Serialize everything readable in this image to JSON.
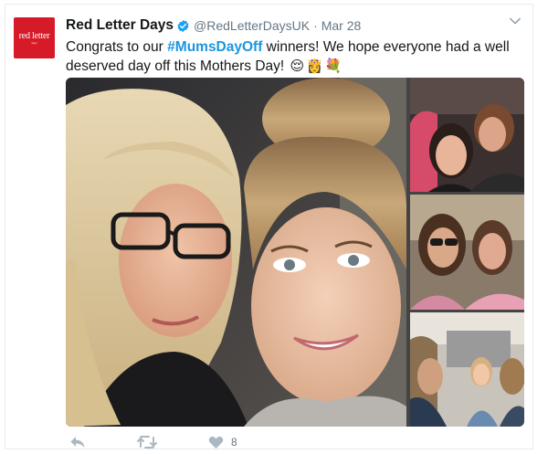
{
  "tweet": {
    "account_name": "Red Letter Days",
    "handle": "@RedLetterDaysUK",
    "separator": "·",
    "date": "Mar 28",
    "avatar_logo": "red letter",
    "avatar_logo_sub": "days",
    "text_before": "Congrats to our ",
    "hashtag": "#MumsDayOff",
    "text_after": " winners! We hope everyone had a well deserved day off this Mothers Day! ",
    "emojis": [
      "😌",
      "👸",
      "💐"
    ],
    "like_count": "8"
  },
  "icons": {
    "verified": "verified-badge-icon",
    "menu": "chevron-down-icon",
    "reply": "reply-icon",
    "retweet": "retweet-icon",
    "like": "heart-icon"
  },
  "colors": {
    "brand_red": "#d71a28",
    "hashtag_blue": "#1b95e0",
    "verified_blue": "#1da1f2",
    "text_dark": "#14171a",
    "text_gray": "#657786",
    "icon_gray": "#aab8c2"
  }
}
